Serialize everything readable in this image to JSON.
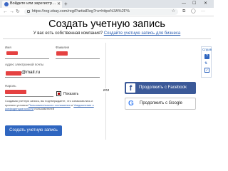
{
  "browser": {
    "tab_title": "Войдите или зарегистр…",
    "tab_close": "✕",
    "new_tab": "+",
    "minimize": "—",
    "maximize": "☐",
    "close": "✕",
    "url": "https://reg.ebay.com/reg/PartialReg?ru=https%3A%2F%"
  },
  "page": {
    "title": "Создать учетную запись",
    "subtitle_prefix": "У вас есть собственная компания?",
    "subtitle_link": "Создайте учетную запись для бизнеса"
  },
  "form": {
    "first_name_label": "Имя",
    "last_name_label": "Фамилия",
    "email_label": "Адрес электронной почты",
    "email_suffix": "@mail.ru",
    "password_label": "Пароль",
    "show_password_label": "Показать",
    "terms_text": "Создавая учетную запись, вы подтверждаете, что ознакомились и приняли условия",
    "terms_link_agreement": "Пользовательского соглашения",
    "terms_and": "и",
    "terms_link_privacy": "Уведомление о конфиденциальности",
    "terms_cont": "пользователей",
    "create_button": "Создать учетную запись"
  },
  "separator": {
    "or": "или"
  },
  "social": {
    "facebook_label": "Продолжить с Facebook",
    "google_label": "Продолжить с Google"
  },
  "help": {
    "label": "Справ",
    "question": "?",
    "arrows": "⇅",
    "check": "✓"
  },
  "colors": {
    "primary_blue": "#2f66c0",
    "facebook_blue": "#3b5998",
    "redaction_red": "#e02020"
  }
}
